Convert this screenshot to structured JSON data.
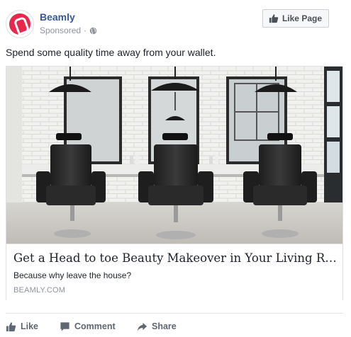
{
  "header": {
    "page_name": "Beamly",
    "sponsored_label": "Sponsored",
    "separator": "·",
    "like_page_label": "Like Page"
  },
  "post": {
    "text": "Spend some quality time away from your wallet."
  },
  "link_card": {
    "title": "Get a Head to toe Beauty Makeover in Your Living Roo...",
    "description": "Because why leave the house?",
    "domain": "BEAMLY.COM"
  },
  "actions": {
    "like_label": "Like",
    "comment_label": "Comment",
    "share_label": "Share"
  },
  "colors": {
    "brand_accent": "#e8274b",
    "page_name": "#365899",
    "muted_text": "#90949c"
  }
}
